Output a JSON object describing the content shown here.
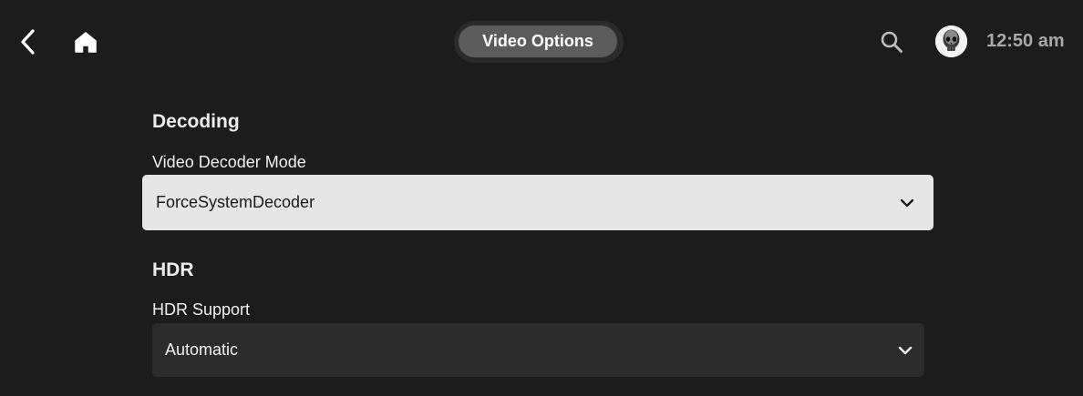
{
  "header": {
    "title": "Video Options",
    "clock": "12:50 am",
    "icons": {
      "back": "chevron-left-icon",
      "home": "home-icon",
      "search": "search-icon",
      "avatar": "skull-avatar"
    }
  },
  "sections": [
    {
      "title": "Decoding",
      "field_label": "Video Decoder Mode",
      "selected_value": "ForceSystemDecoder",
      "focused": true
    },
    {
      "title": "HDR",
      "field_label": "HDR Support",
      "selected_value": "Automatic",
      "focused": false
    }
  ],
  "colors": {
    "background": "#1c1c1c",
    "focused_select": "#e6e6e6",
    "select": "#2c2c2c",
    "title_pill": "#5c5c5c"
  }
}
